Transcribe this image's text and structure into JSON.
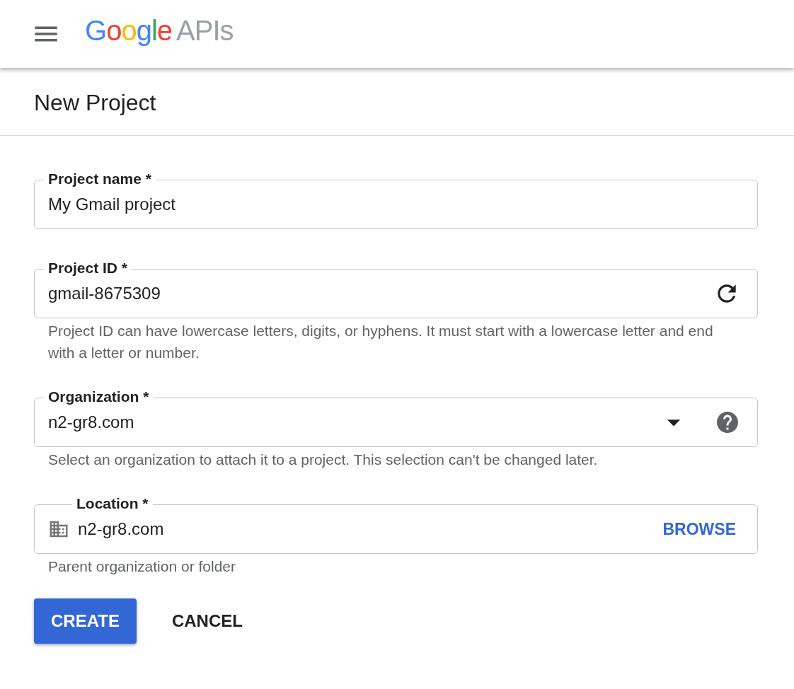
{
  "logo": {
    "brand": "Google",
    "product": "APIs"
  },
  "page_title": "New Project",
  "fields": [
    {
      "kind": "text",
      "label": "Project name *",
      "value": "My Gmail project"
    },
    {
      "kind": "id",
      "label": "Project ID *",
      "value": "gmail-8675309",
      "helper": "Project ID can have lowercase letters, digits, or hyphens. It must start with a lowercase letter and end with a letter or number."
    },
    {
      "kind": "select",
      "label": "Organization *",
      "value": "n2-gr8.com",
      "helper": "Select an organization to attach it to a project. This selection can't be changed later."
    },
    {
      "kind": "location",
      "label": "Location *",
      "value": "n2-gr8.com",
      "action": "BROWSE",
      "helper": "Parent organization or folder"
    }
  ],
  "buttons": [
    {
      "label": "CREATE",
      "primary": true
    },
    {
      "label": "CANCEL",
      "primary": false
    }
  ]
}
